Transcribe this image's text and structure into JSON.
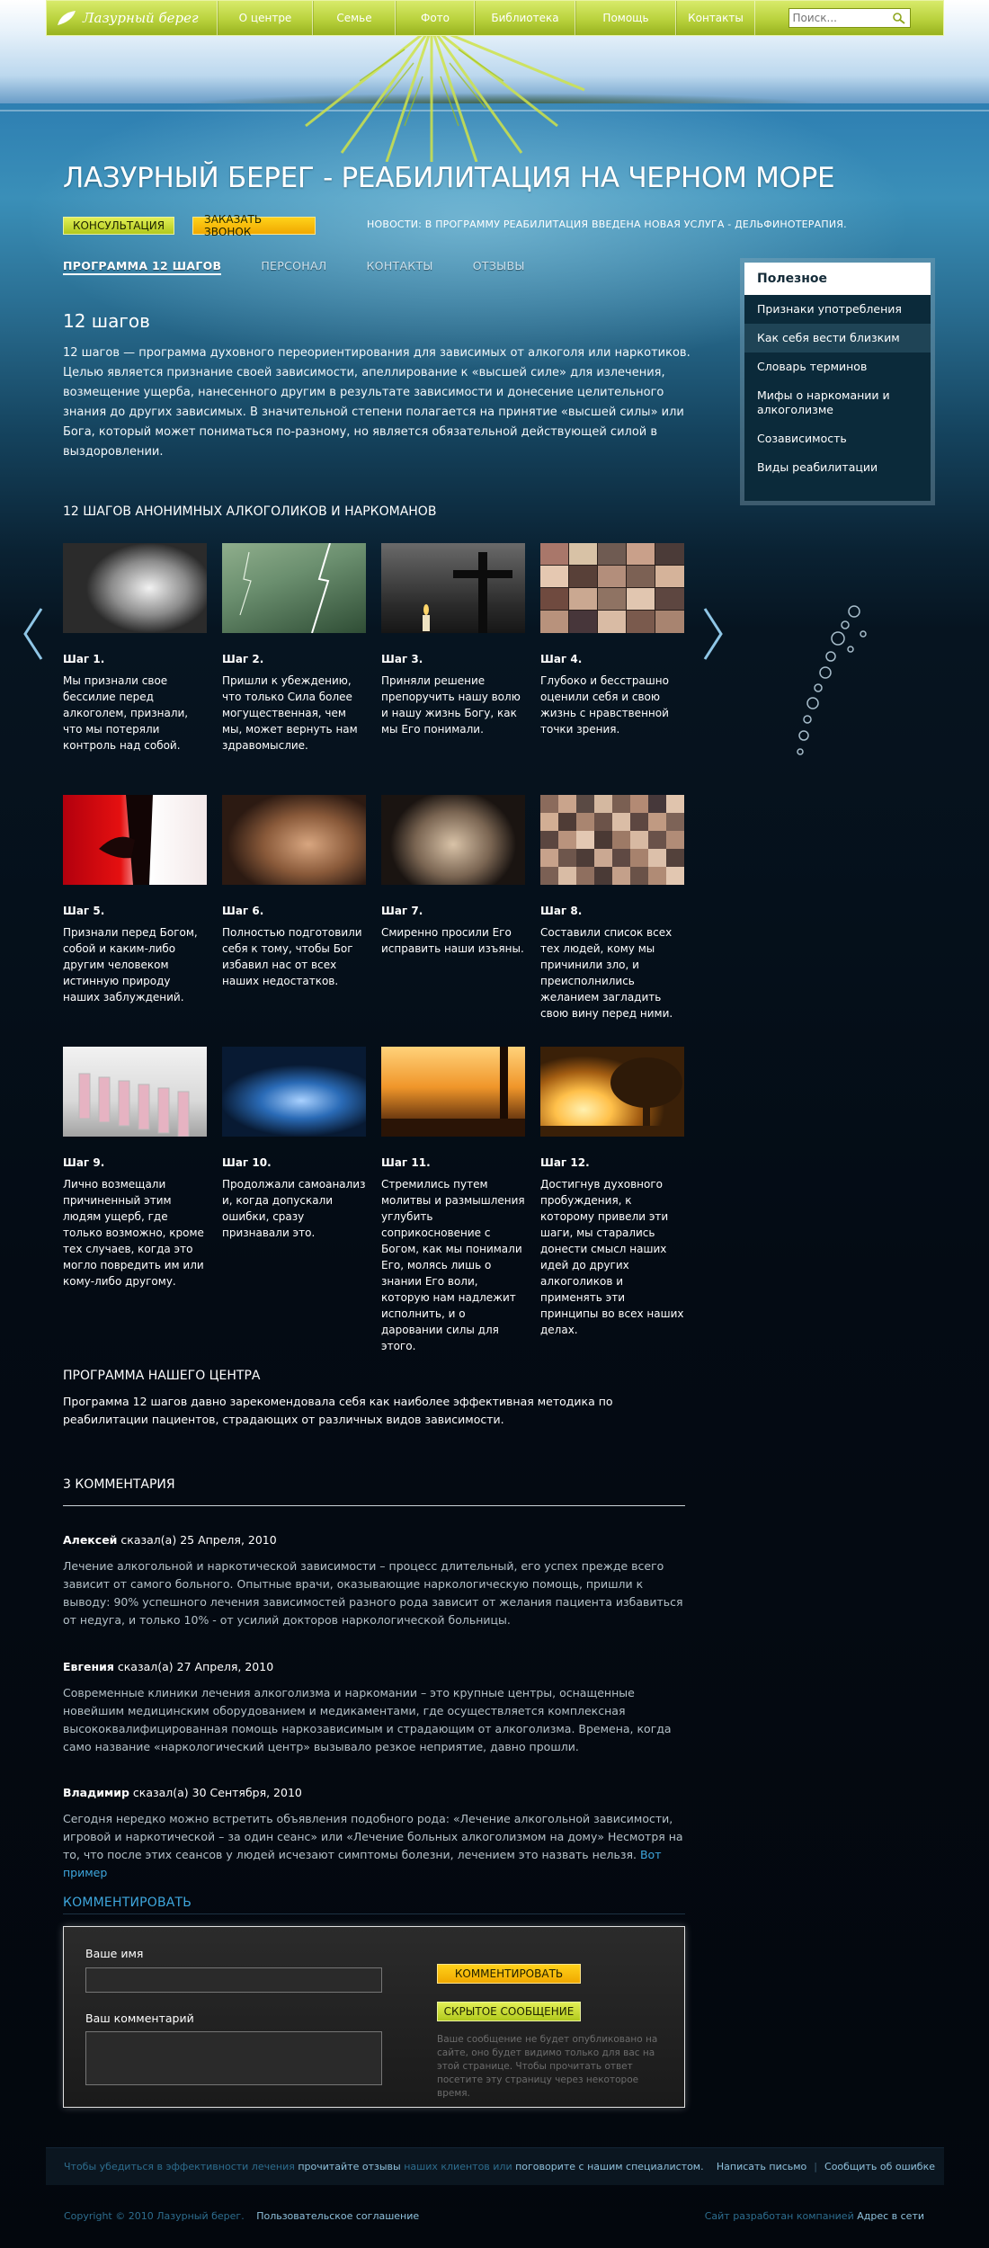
{
  "nav": {
    "logo": "Лазурный берег",
    "items": [
      "О центре",
      "Семье",
      "Фото",
      "Библиотека",
      "Помощь",
      "Контакты"
    ],
    "search_placeholder": "Поиск..."
  },
  "header": {
    "title": "ЛАЗУРНЫЙ БЕРЕГ - РЕАБИЛИТАЦИЯ НА ЧЕРНОМ МОРЕ",
    "btn_consult": "КОНСУЛЬТАЦИЯ",
    "btn_call": "ЗАКАЗАТЬ ЗВОНОК",
    "news": "НОВОСТИ: В ПРОГРАММУ РЕАБИЛИТАЦИЯ ВВЕДЕНА НОВАЯ УСЛУГА - ДЕЛЬФИНОТЕРАПИЯ."
  },
  "tabs": [
    "ПРОГРАММА 12 ШАГОВ",
    "ПЕРСОНАЛ",
    "КОНТАКТЫ",
    "ОТЗЫВЫ"
  ],
  "intro": {
    "heading": "12 шагов",
    "text": "12 шагов — программа духовного переориентирования для зависимых от алкоголя или наркотиков. Целью является признание своей зависимости, апеллирование к «высшей силе» для излечения, возмещение ущерба, нанесенного другим в результате зависимости и донесение целительного знания до других зависимых. В значительной степени полагается на принятие «высшей силы» или Бога, который может пониматься по-разному, но является обязательной действующей силой в выздоровлении."
  },
  "sidebar": {
    "title": "Полезное",
    "items": [
      "Признаки употребления",
      "Как себя вести близким",
      "Словарь терминов",
      "Мифы о наркомании и алкоголизме",
      "Созависимость",
      "Виды реабилитации"
    ]
  },
  "gallery": {
    "heading": "12 ШАГОВ АНОНИМНЫХ АЛКОГОЛИКОВ И НАРКОМАНОВ",
    "steps": [
      {
        "title": "Шаг 1.",
        "text": "Мы признали свое бессилие перед алкоголем, признали, что мы потеряли контроль над собой."
      },
      {
        "title": "Шаг 2.",
        "text": "Пришли к убеждению, что только Сила более могущественная, чем мы, может вернуть нам здравомыслие."
      },
      {
        "title": "Шаг 3.",
        "text": "Приняли решение препоручить нашу волю и нашу жизнь Богу, как мы Его понимали."
      },
      {
        "title": "Шаг 4.",
        "text": "Глубоко и бесстрашно оценили себя и свою жизнь с нравственной точки зрения."
      },
      {
        "title": "Шаг 5.",
        "text": "Признали перед Богом, собой и каким-либо другим человеком истинную природу наших заблуждений."
      },
      {
        "title": "Шаг 6.",
        "text": "Полностью подготовили себя к тому, чтобы Бог избавил нас от всех наших недостатков."
      },
      {
        "title": "Шаг 7.",
        "text": "Смиренно просили Его исправить наши изъяны."
      },
      {
        "title": "Шаг 8.",
        "text": "Составили список всех тех людей, кому мы причинили зло, и преисполнились желанием загладить свою вину перед ними."
      },
      {
        "title": "Шаг 9.",
        "text": "Лично возмещали причиненный этим людям ущерб, где только возможно, кроме тех случаев, когда это могло повредить им или кому-либо другому."
      },
      {
        "title": "Шаг 10.",
        "text": "Продолжали самоанализ и, когда допускали ошибки, сразу признавали это."
      },
      {
        "title": "Шаг 11.",
        "text": "Стремились путем молитвы и размышления углубить соприкосновение с Богом, как мы понимали Его, молясь лишь о знании Его воли, которую нам надлежит исполнить, и о даровании силы для этого."
      },
      {
        "title": "Шаг 12.",
        "text": "Достигнув духовного пробуждения, к которому привели эти шаги, мы старались донести смысл наших идей до других алкоголиков и применять эти принципы во всех наших делах."
      }
    ]
  },
  "program": {
    "heading": "ПРОГРАММА НАШЕГО ЦЕНТРА",
    "text": "Программа 12 шагов давно зарекомендовала себя как наиболее эффективная методика по реабилитации пациентов, страдающих от различных видов зависимости."
  },
  "comments": {
    "heading": "3 КОММЕНТАРИЯ",
    "said": "сказал(а)",
    "items": [
      {
        "author": "Алексей",
        "date": "25 Апреля, 2010",
        "text": "Лечение алкогольной и наркотической зависимости – процесс длительный, его успех прежде всего зависит от самого больного. Опытные врачи, оказывающие наркологическую помощь, пришли к выводу: 90% успешного лечения зависимостей разного рода зависит от желания пациента избавиться от недуга, и только 10% - от усилий докторов наркологической больницы."
      },
      {
        "author": "Евгения",
        "date": "27 Апреля, 2010",
        "text": "Современные клиники лечения алкоголизма и наркомании – это крупные центры, оснащенные новейшим медицинским оборудованием и медикаментами, где осуществляется комплексная высококвалифицированная помощь наркозависимым и страдающим от алкоголизма. Времена, когда само название «наркологический центр» вызывало резкое неприятие, давно прошли."
      },
      {
        "author": "Владимир",
        "date": "30 Сентября, 2010",
        "text": "Сегодня нередко можно встретить объявления подобного рода: «Лечение алкогольной зависимости, игровой и наркотической – за один сеанс» или «Лечение больных алкоголизмом на дому» Несмотря на то, что после этих сеансов у людей исчезают симптомы болезни, лечением это назвать нельзя.",
        "link": "Вот пример"
      }
    ]
  },
  "form": {
    "heading": "КОММЕНТИРОВАТЬ",
    "name_label": "Ваше имя",
    "comment_label": "Ваш комментарий",
    "btn_comment": "КОММЕНТИРОВАТЬ",
    "btn_hidden": "СКРЫТОЕ СООБЩЕНИЕ",
    "note": "Ваше сообщение не будет опубликовано на сайте, оно будет видимо только для вас на этой странице. Чтобы прочитать ответ посетите эту страницу через некоторое время."
  },
  "footer": {
    "text1": "Чтобы убедиться в эффективности лечения",
    "link1": "прочитайте отзывы",
    "text2": "наших клиентов или",
    "link2": "поговорите с нашим специалистом.",
    "write": "Написать письмо",
    "report": "Сообщить об ошибке",
    "copyright": "Copyright © 2010 Лазурный берег.",
    "agreement": "Пользовательское соглашение",
    "dev_text": "Сайт разработан компанией",
    "dev_link": "Адрес в сети"
  },
  "colors": {
    "nav_green": "#b9d23d",
    "button_yellow": "#f0a800",
    "link_blue": "#3ea6dd",
    "sidebar_bg": "#0b2a3a"
  }
}
